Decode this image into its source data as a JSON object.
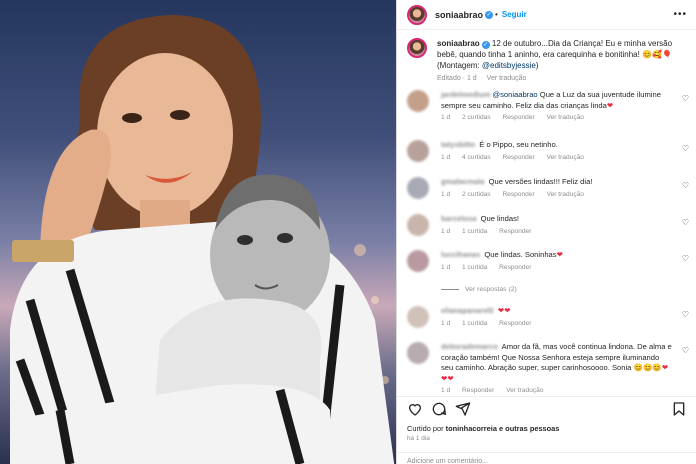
{
  "photo": {
    "description_icon": "portrait-photo"
  },
  "header": {
    "username": "soniaabrao",
    "follow_label": "Seguir",
    "separator": "•"
  },
  "caption": {
    "username": "soniaabrao",
    "text": " 12 de outubro...Dia da Criança! Eu e minha versão bebê, quando tinha 1 aninho, era carequinha e bonitinha! 😊🥰🎈(Montagem: ",
    "mention": "@editsbyjessie",
    "closing": ")",
    "meta_edited": "Editado · 1 d",
    "meta_translate": "Ver tradução"
  },
  "comments": [
    {
      "user": "jardelmedium",
      "mention": "@soniaabrao",
      "text": " Que a Luz da sua juventude ilumine sempre seu caminho. Feliz dia das crianças linda",
      "emoji": "❤",
      "time": "1 d",
      "likes": "2 curtidas",
      "reply": "Responder",
      "translate": "Ver tradução",
      "avatar_color": "#c4a08a"
    },
    {
      "user": "tatysbitto",
      "mention": "",
      "text": " É o Pippo, seu netinho.",
      "emoji": "",
      "time": "1 d",
      "likes": "4 curtidas",
      "reply": "Responder",
      "translate": "Ver tradução",
      "avatar_color": "#b7a19a"
    },
    {
      "user": "gmalacmala",
      "mention": "",
      "text": " Que versões lindas!!! Feliz dia!",
      "emoji": "",
      "time": "1 d",
      "likes": "2 curtidas",
      "reply": "Responder",
      "translate": "Ver tradução",
      "avatar_color": "#a7aab5"
    },
    {
      "user": "barcelosa",
      "mention": "",
      "text": " Que lindas!",
      "emoji": "",
      "time": "1 d",
      "likes": "1 curtida",
      "reply": "Responder",
      "translate": "",
      "avatar_color": "#c9b5ac"
    },
    {
      "user": "luccihanas",
      "mention": "",
      "text": " Que lindas. Soninhas",
      "emoji": "❤",
      "time": "1 d",
      "likes": "1 curtida",
      "reply": "Responder",
      "translate": "",
      "avatar_color": "#b99aa0"
    },
    {
      "user": "elianapanarelli",
      "mention": "",
      "text": " ",
      "emoji": "❤❤",
      "time": "1 d",
      "likes": "1 curtida",
      "reply": "Responder",
      "translate": "",
      "avatar_color": "#d0c2b9"
    },
    {
      "user": "deborademarco",
      "mention": "",
      "text": " Amor da fã, mas você continua lindona. De alma e coração também! Que Nossa Senhora esteja sempre iluminando seu caminho. Abração super, super carinhosoooo. Sonia ",
      "emoji": "😊😊😊❤❤❤",
      "time": "1 d",
      "likes": "",
      "reply": "Responder",
      "translate": "Ver tradução",
      "avatar_color": "#b7abb0"
    }
  ],
  "replies_label": "Ver respostas (2)",
  "actions": {
    "like": "heart-icon",
    "comment": "comment-icon",
    "share": "share-icon",
    "save": "bookmark-icon"
  },
  "likes": {
    "prefix": "Curtido por ",
    "user": "toninhacorreia",
    "suffix": " e outras pessoas"
  },
  "time": "há 1 dia",
  "add_comment_placeholder": "Adicione um comentário..."
}
